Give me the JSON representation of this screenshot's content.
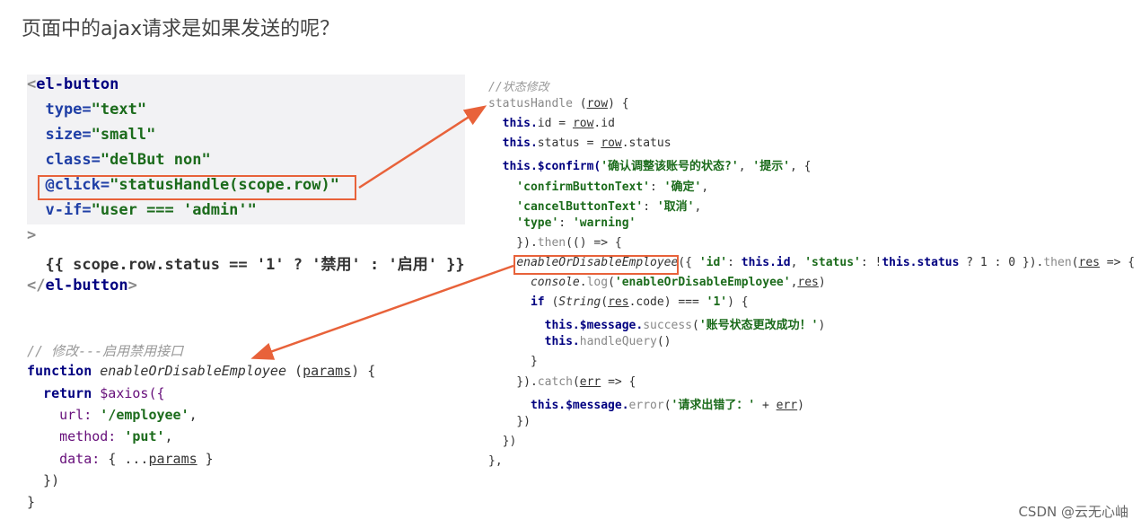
{
  "title": "页面中的ajax请求是如果发送的呢？",
  "watermark": "CSDN @云无心岫",
  "accent_color": "#e8623a",
  "template_code": [
    [
      [
        "<",
        "gray"
      ],
      [
        "el-button",
        "kw"
      ]
    ],
    [
      [
        "  type=",
        "attr"
      ],
      [
        "\"text\"",
        "str"
      ]
    ],
    [
      [
        "  size=",
        "attr"
      ],
      [
        "\"small\"",
        "str"
      ]
    ],
    [
      [
        "  class=",
        "attr"
      ],
      [
        "\"delBut non\"",
        "str"
      ]
    ],
    [
      [
        "  @click=",
        "attr"
      ],
      [
        "\"statusHandle(scope.row)\"",
        "str"
      ]
    ],
    [
      [
        "  v-if=",
        "attr"
      ],
      [
        "\"user === 'admin'\"",
        "str"
      ]
    ],
    [
      [
        ">",
        "gray"
      ]
    ],
    [
      [
        "  {{ scope.row.status == '1' ? '禁用' : '启用' }}",
        "plain"
      ]
    ],
    [
      [
        "</",
        "gray"
      ],
      [
        "el-button",
        "kw"
      ],
      [
        ">",
        "gray"
      ]
    ]
  ],
  "api_code": [
    [
      [
        "// 修改---启用禁用接口",
        "cmt"
      ]
    ],
    [
      [
        "function ",
        "kw"
      ],
      [
        "enableOrDisableEmployee",
        "ital"
      ],
      [
        " (",
        "plain"
      ],
      [
        "params",
        "u"
      ],
      [
        ") {",
        "plain"
      ]
    ],
    [
      [
        "  return ",
        "kw"
      ],
      [
        "$axios({",
        "purple"
      ]
    ],
    [
      [
        "    url: ",
        "purple"
      ],
      [
        "'/employee'",
        "str"
      ],
      [
        ",",
        "plain"
      ]
    ],
    [
      [
        "    method: ",
        "purple"
      ],
      [
        "'put'",
        "str"
      ],
      [
        ",",
        "plain"
      ]
    ],
    [
      [
        "    data: ",
        "purple"
      ],
      [
        "{ ...",
        "plain"
      ],
      [
        "params",
        "u"
      ],
      [
        " }",
        "plain"
      ]
    ],
    [
      [
        "  })",
        "plain"
      ]
    ],
    [
      [
        "}",
        "plain"
      ]
    ]
  ],
  "handler_code": [
    [
      [
        "//状态修改",
        "cmt"
      ]
    ],
    [
      [
        "statusHandle ",
        "gray"
      ],
      [
        "(",
        "plain"
      ],
      [
        "row",
        "u"
      ],
      [
        ") {",
        "plain"
      ]
    ],
    [
      [
        "  this.",
        "kw"
      ],
      [
        "id = ",
        "plain"
      ],
      [
        "row",
        "u"
      ],
      [
        ".id",
        "plain"
      ]
    ],
    [
      [
        "  this.",
        "kw"
      ],
      [
        "status = ",
        "plain"
      ],
      [
        "row",
        "u"
      ],
      [
        ".status",
        "plain"
      ]
    ],
    [
      [
        "  this.$confirm(",
        "kw"
      ],
      [
        "'确认调整该账号的状态?'",
        "str"
      ],
      [
        ", ",
        "plain"
      ],
      [
        "'提示'",
        "str"
      ],
      [
        ", {",
        "plain"
      ]
    ],
    [
      [
        "    'confirmButtonText'",
        "str"
      ],
      [
        ": ",
        "plain"
      ],
      [
        "'确定'",
        "str"
      ],
      [
        ",",
        "plain"
      ]
    ],
    [
      [
        "    'cancelButtonText'",
        "str"
      ],
      [
        ": ",
        "plain"
      ],
      [
        "'取消'",
        "str"
      ],
      [
        ",",
        "plain"
      ]
    ],
    [
      [
        "    'type'",
        "str"
      ],
      [
        ": ",
        "plain"
      ],
      [
        "'warning'",
        "str"
      ]
    ],
    [
      [
        "    }).",
        "plain"
      ],
      [
        "then",
        "gray"
      ],
      [
        "(() => {",
        "plain"
      ]
    ],
    [
      [
        "    ",
        "plain"
      ],
      [
        "enableOrDisableEmployee",
        "ital"
      ],
      [
        "({ ",
        "plain"
      ],
      [
        "'id'",
        "str"
      ],
      [
        ": ",
        "plain"
      ],
      [
        "this.id",
        "kw"
      ],
      [
        ", ",
        "plain"
      ],
      [
        "'status'",
        "str"
      ],
      [
        ": !",
        "plain"
      ],
      [
        "this.status",
        "kw"
      ],
      [
        " ? 1 : 0 }).",
        "plain"
      ],
      [
        "then",
        "gray"
      ],
      [
        "(",
        "plain"
      ],
      [
        "res",
        "u"
      ],
      [
        " => {",
        "plain"
      ]
    ],
    [
      [
        "      console",
        "ital"
      ],
      [
        ".",
        "plain"
      ],
      [
        "log",
        "gray"
      ],
      [
        "(",
        "plain"
      ],
      [
        "'enableOrDisableEmployee'",
        "str"
      ],
      [
        ",",
        "plain"
      ],
      [
        "res",
        "u"
      ],
      [
        ")",
        "plain"
      ]
    ],
    [
      [
        "      if ",
        "kw"
      ],
      [
        "(",
        "plain"
      ],
      [
        "String",
        "ital"
      ],
      [
        "(",
        "plain"
      ],
      [
        "res",
        "u"
      ],
      [
        ".code) === ",
        "plain"
      ],
      [
        "'1'",
        "str"
      ],
      [
        ") {",
        "plain"
      ]
    ],
    [
      [
        "        this.$message.",
        "kw"
      ],
      [
        "success",
        "gray"
      ],
      [
        "(",
        "plain"
      ],
      [
        "'账号状态更改成功！'",
        "str"
      ],
      [
        ")",
        "plain"
      ]
    ],
    [
      [
        "        this.",
        "kw"
      ],
      [
        "handleQuery",
        "gray"
      ],
      [
        "()",
        "plain"
      ]
    ],
    [
      [
        "      }",
        "plain"
      ]
    ],
    [
      [
        "    }).",
        "plain"
      ],
      [
        "catch",
        "gray"
      ],
      [
        "(",
        "plain"
      ],
      [
        "err",
        "u"
      ],
      [
        " => {",
        "plain"
      ]
    ],
    [
      [
        "      this.$message.",
        "kw"
      ],
      [
        "error",
        "gray"
      ],
      [
        "(",
        "plain"
      ],
      [
        "'请求出错了：'",
        "str"
      ],
      [
        " + ",
        "plain"
      ],
      [
        "err",
        "u"
      ],
      [
        ")",
        "plain"
      ]
    ],
    [
      [
        "    })",
        "plain"
      ]
    ],
    [
      [
        "  })",
        "plain"
      ]
    ],
    [
      [
        "},",
        "plain"
      ]
    ]
  ]
}
